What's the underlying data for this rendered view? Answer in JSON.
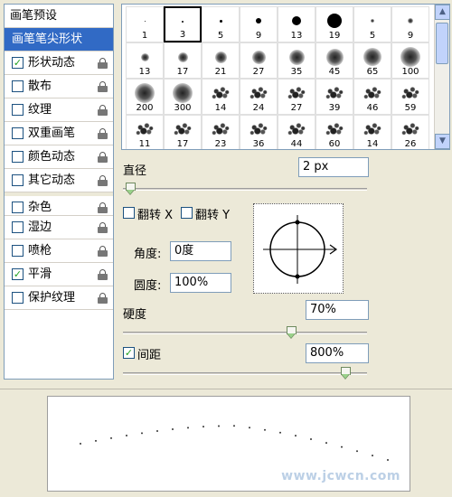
{
  "left_panel": {
    "header": "画笔预设",
    "items": [
      {
        "label": "画笔笔尖形状",
        "checked": null,
        "selected": true,
        "lock": false
      },
      {
        "label": "形状动态",
        "checked": true,
        "selected": false,
        "lock": true
      },
      {
        "label": "散布",
        "checked": false,
        "selected": false,
        "lock": true
      },
      {
        "label": "纹理",
        "checked": false,
        "selected": false,
        "lock": true
      },
      {
        "label": "双重画笔",
        "checked": false,
        "selected": false,
        "lock": true
      },
      {
        "label": "颜色动态",
        "checked": false,
        "selected": false,
        "lock": true
      },
      {
        "label": "其它动态",
        "checked": false,
        "selected": false,
        "lock": true
      },
      {
        "label": "杂色",
        "checked": false,
        "selected": false,
        "lock": true
      },
      {
        "label": "湿边",
        "checked": false,
        "selected": false,
        "lock": true
      },
      {
        "label": "喷枪",
        "checked": false,
        "selected": false,
        "lock": true
      },
      {
        "label": "平滑",
        "checked": true,
        "selected": false,
        "lock": true
      },
      {
        "label": "保护纹理",
        "checked": false,
        "selected": false,
        "lock": true
      }
    ]
  },
  "brush_tips": [
    {
      "size": "1",
      "kind": "hard",
      "d": 1
    },
    {
      "size": "3",
      "kind": "hard",
      "d": 2
    },
    {
      "size": "5",
      "kind": "hard",
      "d": 3
    },
    {
      "size": "9",
      "kind": "hard",
      "d": 6
    },
    {
      "size": "13",
      "kind": "hard",
      "d": 10
    },
    {
      "size": "19",
      "kind": "hard",
      "d": 16
    },
    {
      "size": "5",
      "kind": "soft",
      "d": 4
    },
    {
      "size": "9",
      "kind": "soft",
      "d": 6
    },
    {
      "size": "13",
      "kind": "soft",
      "d": 9
    },
    {
      "size": "17",
      "kind": "soft",
      "d": 11
    },
    {
      "size": "21",
      "kind": "soft",
      "d": 13
    },
    {
      "size": "27",
      "kind": "soft",
      "d": 15
    },
    {
      "size": "35",
      "kind": "soft",
      "d": 17
    },
    {
      "size": "45",
      "kind": "soft",
      "d": 19
    },
    {
      "size": "65",
      "kind": "soft",
      "d": 20
    },
    {
      "size": "100",
      "kind": "soft",
      "d": 22
    },
    {
      "size": "200",
      "kind": "soft",
      "d": 22
    },
    {
      "size": "300",
      "kind": "soft",
      "d": 22
    },
    {
      "size": "14",
      "kind": "splat",
      "d": 0
    },
    {
      "size": "24",
      "kind": "splat",
      "d": 0
    },
    {
      "size": "27",
      "kind": "splat",
      "d": 0
    },
    {
      "size": "39",
      "kind": "splat",
      "d": 0
    },
    {
      "size": "46",
      "kind": "splat",
      "d": 0
    },
    {
      "size": "59",
      "kind": "splat",
      "d": 0
    },
    {
      "size": "11",
      "kind": "splat",
      "d": 0
    },
    {
      "size": "17",
      "kind": "splat",
      "d": 0
    },
    {
      "size": "23",
      "kind": "splat",
      "d": 0
    },
    {
      "size": "36",
      "kind": "splat",
      "d": 0
    },
    {
      "size": "44",
      "kind": "splat",
      "d": 0
    },
    {
      "size": "60",
      "kind": "splat",
      "d": 0
    },
    {
      "size": "14",
      "kind": "splat",
      "d": 0
    },
    {
      "size": "26",
      "kind": "splat",
      "d": 0
    }
  ],
  "selected_tip_index": 1,
  "diameter": {
    "label": "直径",
    "value": "2 px",
    "slider_fraction": 0.01
  },
  "flip": {
    "x_label": "翻转 X",
    "y_label": "翻转 Y",
    "x_checked": false,
    "y_checked": false
  },
  "angle": {
    "label": "角度:",
    "value": "0度"
  },
  "roundness": {
    "label": "圆度:",
    "value": "100%"
  },
  "hardness": {
    "label": "硬度",
    "value": "70%",
    "slider_fraction": 0.7
  },
  "spacing": {
    "label": "间距",
    "value": "800%",
    "checked": true,
    "slider_fraction": 0.93
  },
  "preview": {
    "watermark": "www.jcwcn.com"
  }
}
